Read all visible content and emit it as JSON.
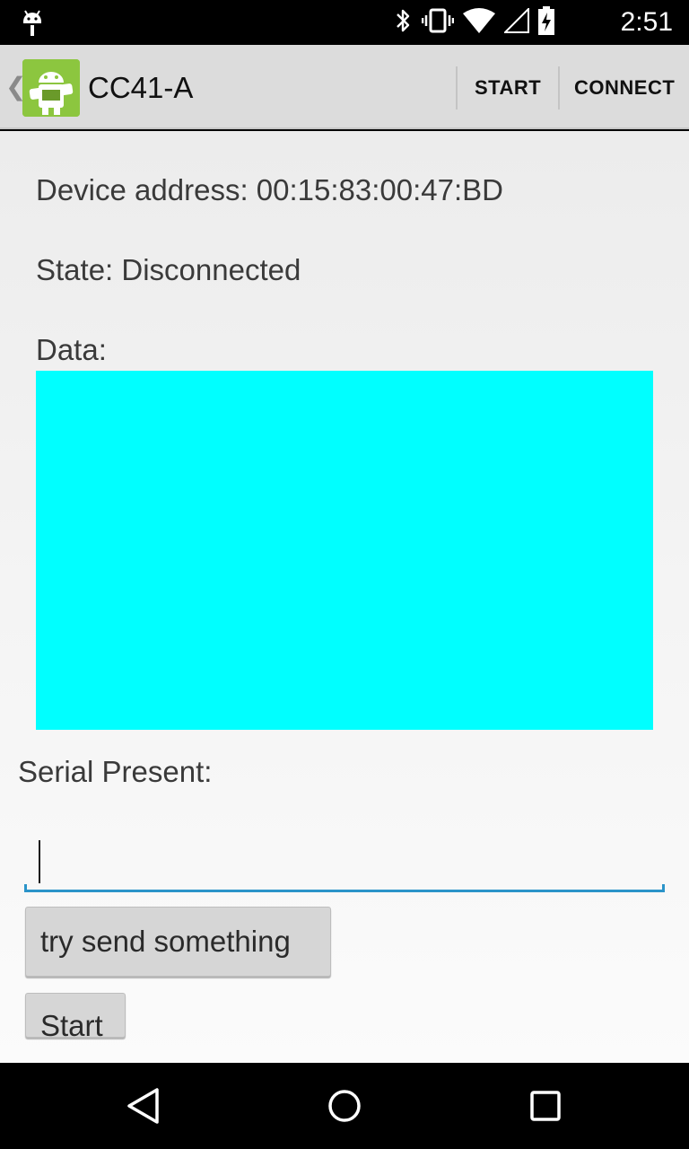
{
  "status_bar": {
    "time": "2:51",
    "icons": [
      "android-debug-icon",
      "bluetooth-icon",
      "vibrate-icon",
      "wifi-icon",
      "cell-signal-icon",
      "battery-charging-icon"
    ]
  },
  "action_bar": {
    "title": "CC41-A",
    "actions": [
      "START",
      "CONNECT"
    ]
  },
  "content": {
    "device_address": "Device address: 00:15:83:00:47:BD",
    "state": "State: Disconnected",
    "data_label": "Data:",
    "serial_label": "Serial Present:",
    "input_value": "",
    "send_button": "try send something",
    "start_button": "Start"
  },
  "colors": {
    "data_area": "#00ffff",
    "accent": "#2b94c9",
    "action_bar": "#dcdcdc"
  },
  "nav_bar": {
    "buttons": [
      "back-icon",
      "home-icon",
      "recents-icon"
    ]
  }
}
